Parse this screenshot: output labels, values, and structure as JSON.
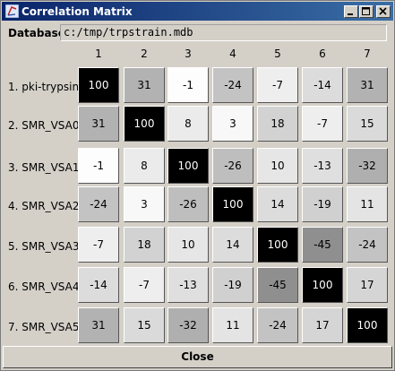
{
  "window": {
    "title": "Correlation Matrix",
    "minimize_icon": "minimize-icon",
    "maximize_icon": "maximize-icon",
    "close_icon": "close-icon"
  },
  "database": {
    "label": "Database:",
    "value": "c:/tmp/trpstrain.mdb"
  },
  "matrix": {
    "columns": [
      "1",
      "2",
      "3",
      "4",
      "5",
      "6",
      "7"
    ],
    "rows": [
      "1. pki-trypsin",
      "2. SMR_VSA0",
      "3. SMR_VSA1",
      "4. SMR_VSA2",
      "5. SMR_VSA3",
      "6. SMR_VSA4",
      "7. SMR_VSA5"
    ],
    "values": [
      [
        100,
        31,
        -1,
        -24,
        -7,
        -14,
        31
      ],
      [
        31,
        100,
        8,
        3,
        18,
        -7,
        15
      ],
      [
        -1,
        8,
        100,
        -26,
        10,
        -13,
        -32
      ],
      [
        -24,
        3,
        -26,
        100,
        14,
        -19,
        11
      ],
      [
        -7,
        18,
        10,
        14,
        100,
        -45,
        -24
      ],
      [
        -14,
        -7,
        -13,
        -19,
        -45,
        100,
        17
      ],
      [
        31,
        15,
        -32,
        11,
        -24,
        17,
        100
      ]
    ]
  },
  "footer": {
    "close_label": "Close"
  }
}
